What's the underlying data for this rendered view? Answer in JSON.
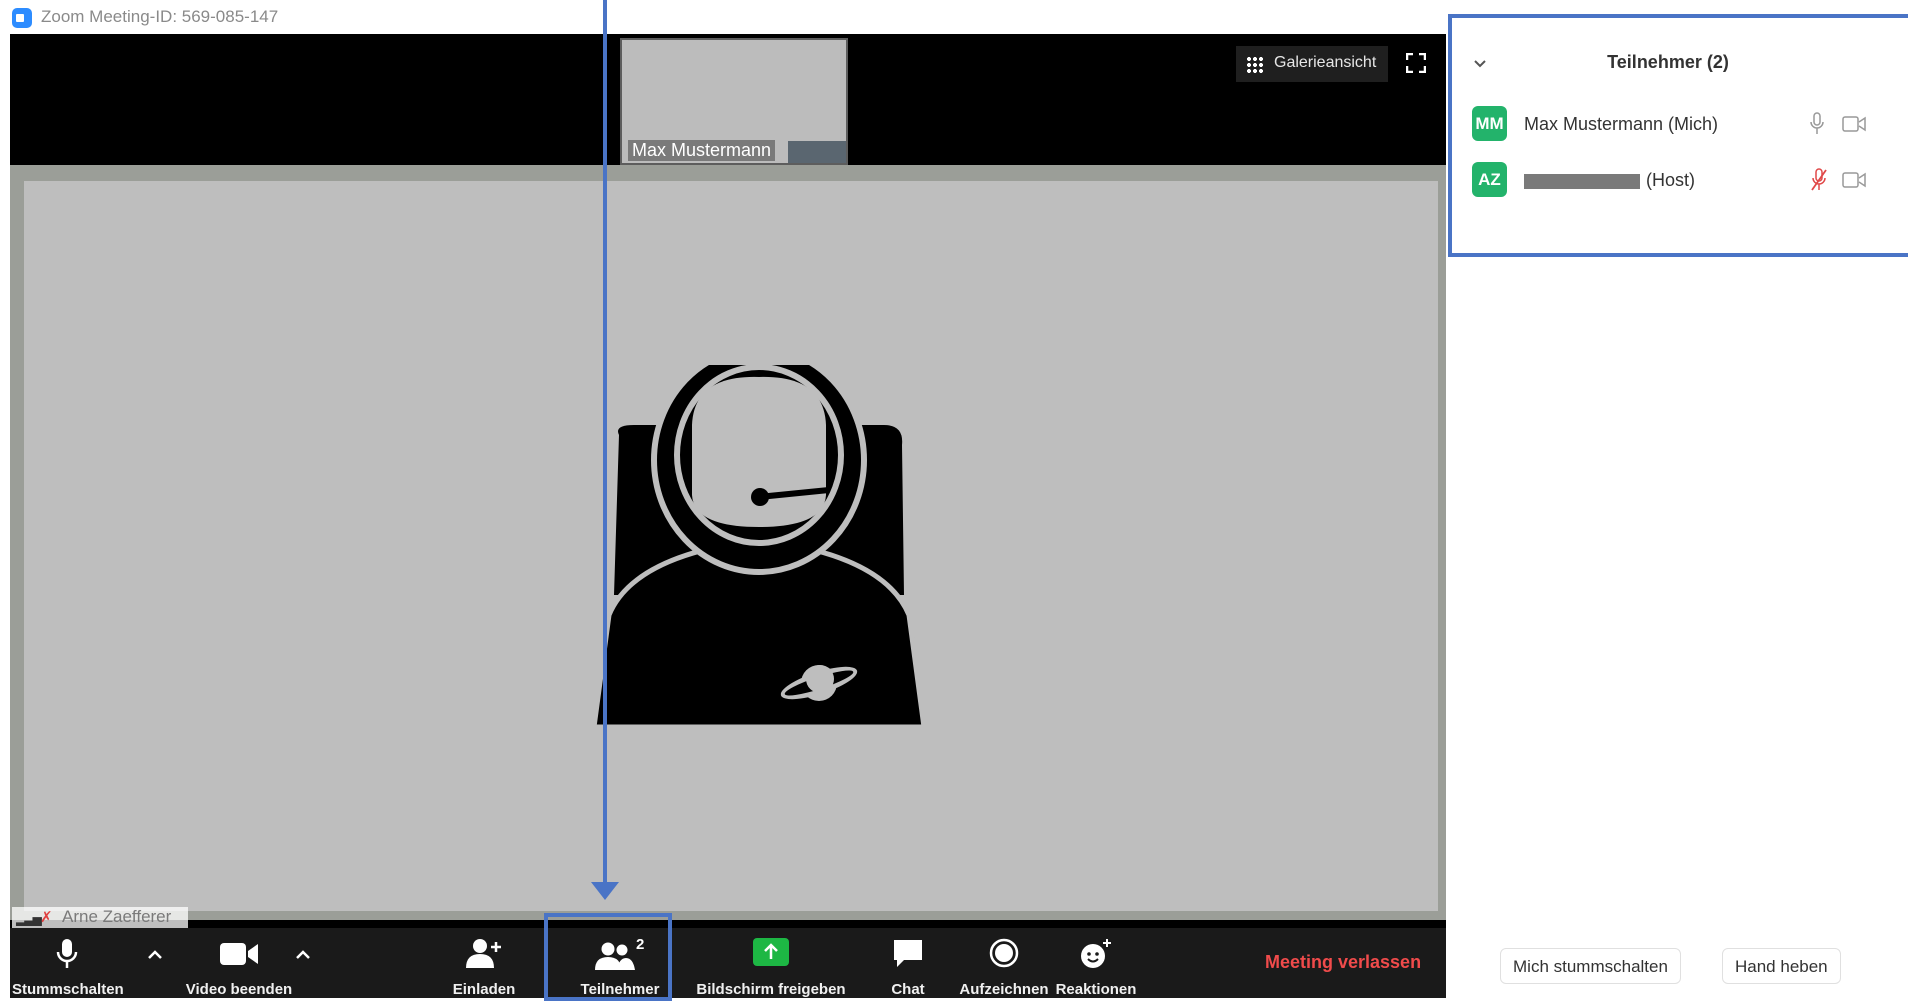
{
  "window": {
    "title": "Zoom Meeting-ID: 569-085-147",
    "restore_glyph": "⧉",
    "close_glyph": "✕"
  },
  "video": {
    "self_thumbnail_name": "Max Mustermann",
    "active_speaker_name": "Arne Zaefferer",
    "gallery_view_label": "Galerieansicht"
  },
  "toolbar": {
    "mute_label": "Stummschalten",
    "video_label": "Video beenden",
    "invite_label": "Einladen",
    "participants_label": "Teilnehmer",
    "participants_count": "2",
    "share_label": "Bildschirm freigeben",
    "chat_label": "Chat",
    "record_label": "Aufzeichnen",
    "reactions_label": "Reaktionen",
    "leave_label": "Meeting verlassen"
  },
  "panel": {
    "title": "Teilnehmer (2)",
    "participants": [
      {
        "initials": "MM",
        "name": "Max Mustermann (Mich)",
        "avatar_color": "#23b36b",
        "mic": "on"
      },
      {
        "initials": "AZ",
        "name": "(Host)",
        "avatar_color": "#23b36b",
        "mic": "muted"
      }
    ],
    "mute_me_label": "Mich stummschalten",
    "raise_hand_label": "Hand heben"
  },
  "colors": {
    "annotation": "#4a74c6",
    "leave": "#f04b4b",
    "share_green": "#1db744",
    "zoom_blue": "#2d8cff"
  }
}
